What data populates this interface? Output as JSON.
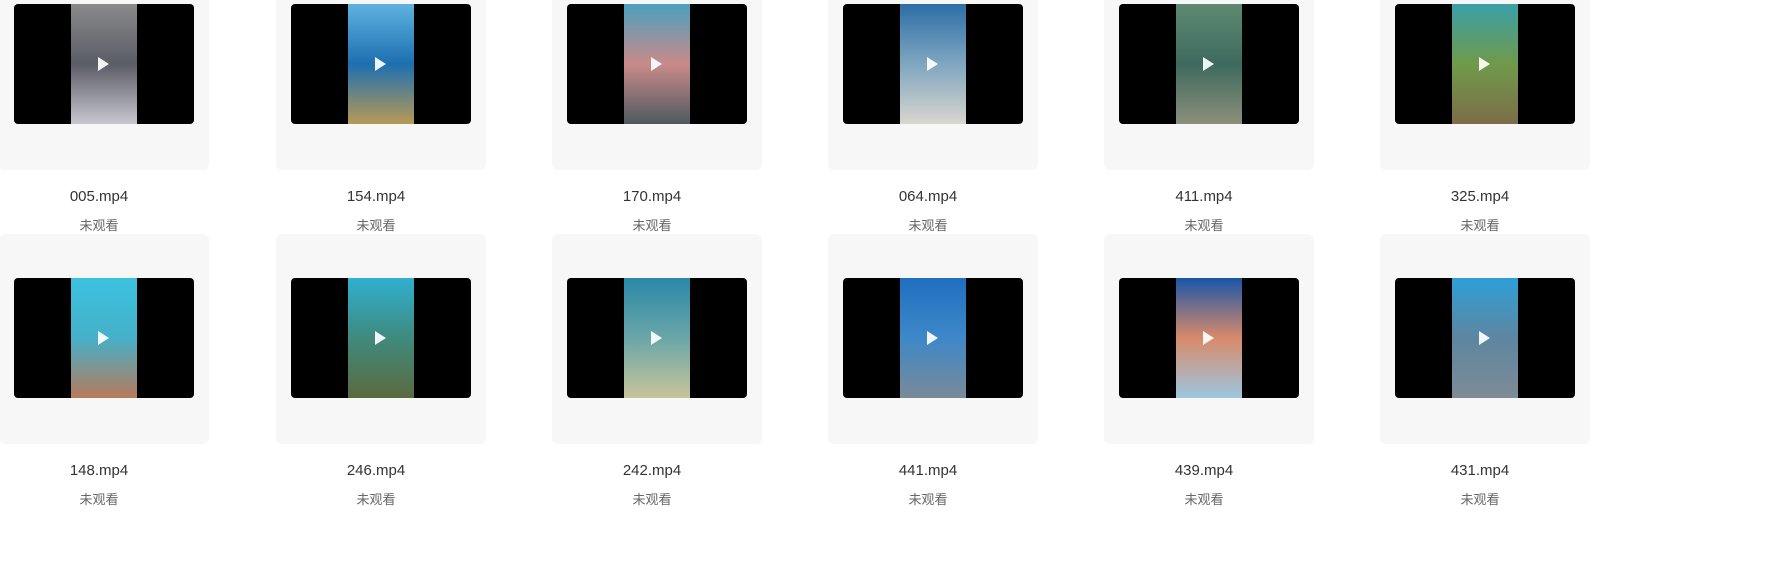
{
  "videos": [
    {
      "name": "005.mp4",
      "status": "未观看",
      "thumb": [
        "#8a8a8c",
        "#5a5c66",
        "#c9c7cf"
      ]
    },
    {
      "name": "154.mp4",
      "status": "未观看",
      "thumb": [
        "#5fb3e0",
        "#1d6fb0",
        "#b89a55"
      ]
    },
    {
      "name": "170.mp4",
      "status": "未观看",
      "thumb": [
        "#4aa0bf",
        "#c98a8a",
        "#4d5a60"
      ]
    },
    {
      "name": "064.mp4",
      "status": "未观看",
      "thumb": [
        "#2c6ea6",
        "#7fa6c0",
        "#d9d6cf"
      ]
    },
    {
      "name": "411.mp4",
      "status": "未观看",
      "thumb": [
        "#5e8a72",
        "#3d6a5e",
        "#8c8f7a"
      ]
    },
    {
      "name": "325.mp4",
      "status": "未观看",
      "thumb": [
        "#3aa0a8",
        "#6f9a4a",
        "#7d6d48"
      ]
    },
    {
      "name": "148.mp4",
      "status": "未观看",
      "thumb": [
        "#3cc2e0",
        "#45b0c8",
        "#b87a5a"
      ]
    },
    {
      "name": "246.mp4",
      "status": "未观看",
      "thumb": [
        "#2fb0d0",
        "#3f8a7e",
        "#5a6a3e"
      ]
    },
    {
      "name": "242.mp4",
      "status": "未观看",
      "thumb": [
        "#2a88a8",
        "#6aa6a8",
        "#c9c49a"
      ]
    },
    {
      "name": "441.mp4",
      "status": "未观看",
      "thumb": [
        "#1f6fc0",
        "#3d88c8",
        "#7a8a98"
      ]
    },
    {
      "name": "439.mp4",
      "status": "未观看",
      "thumb": [
        "#1a55a8",
        "#d98a6a",
        "#9cc6e0"
      ]
    },
    {
      "name": "431.mp4",
      "status": "未观看",
      "thumb": [
        "#2e9fd8",
        "#5d86a0",
        "#7e8c96"
      ]
    }
  ]
}
